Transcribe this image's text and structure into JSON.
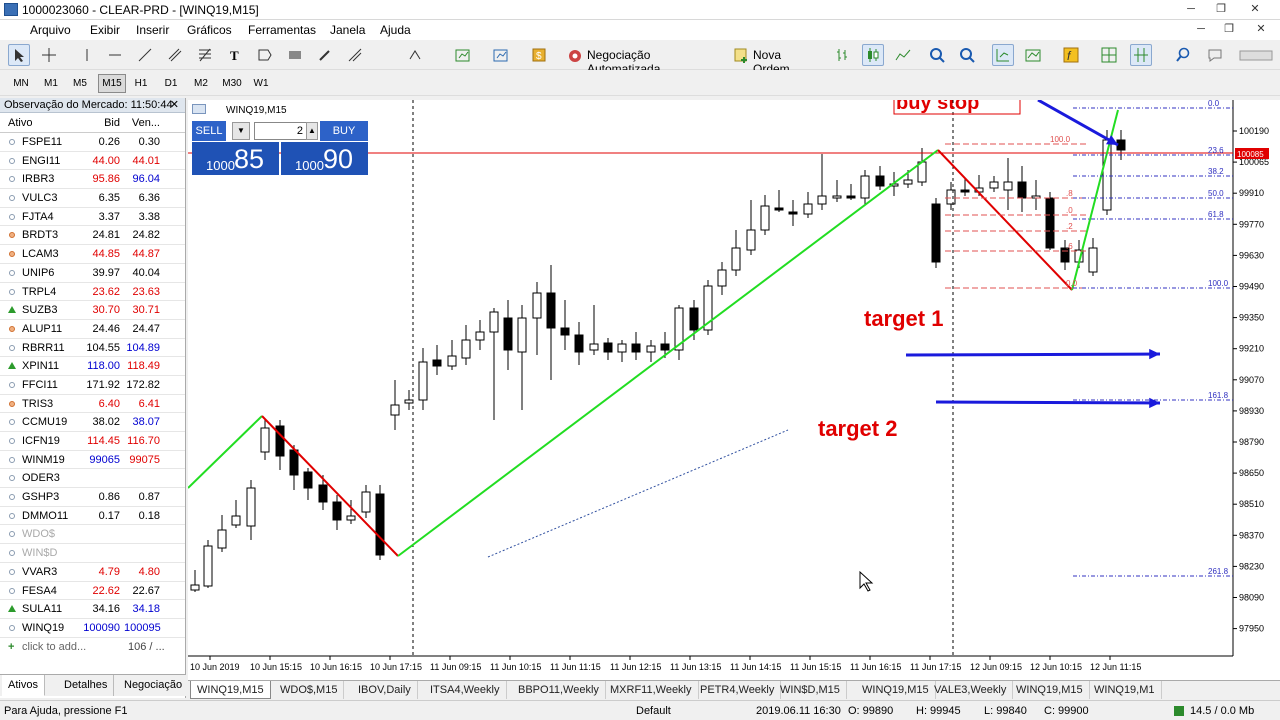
{
  "window": {
    "title": "1000023060 - CLEAR-PRD - [WINQ19,M15]"
  },
  "menu": [
    "Arquivo",
    "Exibir",
    "Inserir",
    "Gráficos",
    "Ferramentas",
    "Janela",
    "Ajuda"
  ],
  "toolbar": {
    "auto_trading": "Negociação Automatizada",
    "new_order": "Nova Ordem"
  },
  "timeframes": [
    "MN",
    "M1",
    "M5",
    "M15",
    "H1",
    "D1",
    "M2",
    "M30",
    "W1"
  ],
  "timeframe_active": "M15",
  "market_watch": {
    "title": "Observação do Mercado: 11:50:44",
    "col_symbol": "Ativo",
    "col_bid": "Bid",
    "col_ask": "Ven...",
    "rows": [
      {
        "s": "FSPE11",
        "b": "0.26",
        "a": "0.30",
        "i": "n",
        "bc": "",
        "ac": ""
      },
      {
        "s": "ENGI11",
        "b": "44.00",
        "a": "44.01",
        "i": "n",
        "bc": "red",
        "ac": "red"
      },
      {
        "s": "IRBR3",
        "b": "95.86",
        "a": "96.04",
        "i": "n",
        "bc": "red",
        "ac": "blue"
      },
      {
        "s": "VULC3",
        "b": "6.35",
        "a": "6.36",
        "i": "n",
        "bc": "",
        "ac": ""
      },
      {
        "s": "FJTA4",
        "b": "3.37",
        "a": "3.38",
        "i": "n",
        "bc": "",
        "ac": ""
      },
      {
        "s": "BRDT3",
        "b": "24.81",
        "a": "24.82",
        "i": "hot",
        "bc": "",
        "ac": ""
      },
      {
        "s": "LCAM3",
        "b": "44.85",
        "a": "44.87",
        "i": "hot",
        "bc": "red",
        "ac": "red"
      },
      {
        "s": "UNIP6",
        "b": "39.97",
        "a": "40.04",
        "i": "n",
        "bc": "",
        "ac": ""
      },
      {
        "s": "TRPL4",
        "b": "23.62",
        "a": "23.63",
        "i": "n",
        "bc": "red",
        "ac": "red"
      },
      {
        "s": "SUZB3",
        "b": "30.70",
        "a": "30.71",
        "i": "up",
        "bc": "red",
        "ac": "red"
      },
      {
        "s": "ALUP11",
        "b": "24.46",
        "a": "24.47",
        "i": "hot",
        "bc": "",
        "ac": ""
      },
      {
        "s": "RBRR11",
        "b": "104.55",
        "a": "104.89",
        "i": "n",
        "bc": "",
        "ac": "blue"
      },
      {
        "s": "XPIN11",
        "b": "118.00",
        "a": "118.49",
        "i": "up",
        "bc": "blue",
        "ac": "red"
      },
      {
        "s": "FFCI11",
        "b": "171.92",
        "a": "172.82",
        "i": "n",
        "bc": "",
        "ac": ""
      },
      {
        "s": "TRIS3",
        "b": "6.40",
        "a": "6.41",
        "i": "hot",
        "bc": "red",
        "ac": "red"
      },
      {
        "s": "CCMU19",
        "b": "38.02",
        "a": "38.07",
        "i": "n",
        "bc": "",
        "ac": "blue"
      },
      {
        "s": "ICFN19",
        "b": "114.45",
        "a": "116.70",
        "i": "n",
        "bc": "red",
        "ac": "red"
      },
      {
        "s": "WINM19",
        "b": "99065",
        "a": "99075",
        "i": "n",
        "bc": "blue",
        "ac": "red"
      },
      {
        "s": "ODER3",
        "b": "",
        "a": "",
        "i": "n",
        "bc": "",
        "ac": ""
      },
      {
        "s": "GSHP3",
        "b": "0.86",
        "a": "0.87",
        "i": "n",
        "bc": "",
        "ac": ""
      },
      {
        "s": "DMMO11",
        "b": "0.17",
        "a": "0.18",
        "i": "n",
        "bc": "",
        "ac": ""
      },
      {
        "s": "WDO$",
        "b": "",
        "a": "",
        "i": "n",
        "bc": "",
        "ac": "",
        "g": true
      },
      {
        "s": "WIN$D",
        "b": "",
        "a": "",
        "i": "n",
        "bc": "",
        "ac": "",
        "g": true
      },
      {
        "s": "VVAR3",
        "b": "4.79",
        "a": "4.80",
        "i": "n",
        "bc": "red",
        "ac": "red"
      },
      {
        "s": "FESA4",
        "b": "22.62",
        "a": "22.67",
        "i": "n",
        "bc": "red",
        "ac": ""
      },
      {
        "s": "SULA11",
        "b": "34.16",
        "a": "34.18",
        "i": "up",
        "bc": "",
        "ac": "blue"
      },
      {
        "s": "WINQ19",
        "b": "100090",
        "a": "100095",
        "i": "n",
        "bc": "blue",
        "ac": "blue"
      }
    ],
    "add_label": "click to add...",
    "count": "106 / ...",
    "tabs": [
      "Ativos",
      "Detalhes",
      "Negociação"
    ]
  },
  "chart": {
    "label": "WINQ19,M15",
    "sell": "SELL",
    "buy": "BUY",
    "volume": "2",
    "sell_small": "1000",
    "sell_big": "85",
    "buy_small": "1000",
    "buy_big": "90",
    "annotations": {
      "buy_stop": "buy stop",
      "target1": "target 1",
      "target2": "target 2"
    },
    "price_ticks": [
      "100190",
      "100065",
      "99910",
      "99770",
      "99630",
      "99490",
      "99350",
      "99210",
      "99070",
      "98930",
      "98790",
      "98650",
      "98510",
      "98370",
      "98230",
      "98090",
      "97950"
    ],
    "current_price": "100085",
    "fib_right": [
      "0.0",
      "23.6",
      "38.2",
      "50.0",
      "61.8",
      "100.0",
      "161.8",
      "261.8"
    ],
    "fib_left": [
      "100.0",
      ".8",
      ".0",
      ".2",
      ".6",
      "0.0"
    ],
    "time_ticks": [
      "10 Jun 2019",
      "10 Jun 15:15",
      "10 Jun 16:15",
      "10 Jun 17:15",
      "11 Jun 09:15",
      "11 Jun 10:15",
      "11 Jun 11:15",
      "11 Jun 12:15",
      "11 Jun 13:15",
      "11 Jun 14:15",
      "11 Jun 15:15",
      "11 Jun 16:15",
      "11 Jun 17:15",
      "12 Jun 09:15",
      "12 Jun 10:15",
      "12 Jun 11:15"
    ],
    "colors": {
      "up_leg": "#22dd22",
      "down_leg": "#e00000",
      "arrow": "#1a1adc",
      "fib": "#e05050",
      "fib_blue": "#3030c0"
    }
  },
  "chart_tabs": [
    "WINQ19,M15",
    "WDO$,M15",
    "IBOV,Daily",
    "ITSA4,Weekly",
    "BBPO11,Weekly",
    "MXRF11,Weekly",
    "PETR4,Weekly",
    "WIN$D,M15",
    "WINQ19,M15",
    "VALE3,Weekly",
    "WINQ19,M15",
    "WINQ19,M1"
  ],
  "status": {
    "help": "Para Ajuda, pressione F1",
    "profile": "Default",
    "datetime": "2019.06.11 16:30",
    "open": "O: 99890",
    "high": "H: 99945",
    "low": "L: 99840",
    "close": "C: 99900",
    "traffic": "14.5 / 0.0 Mb"
  }
}
